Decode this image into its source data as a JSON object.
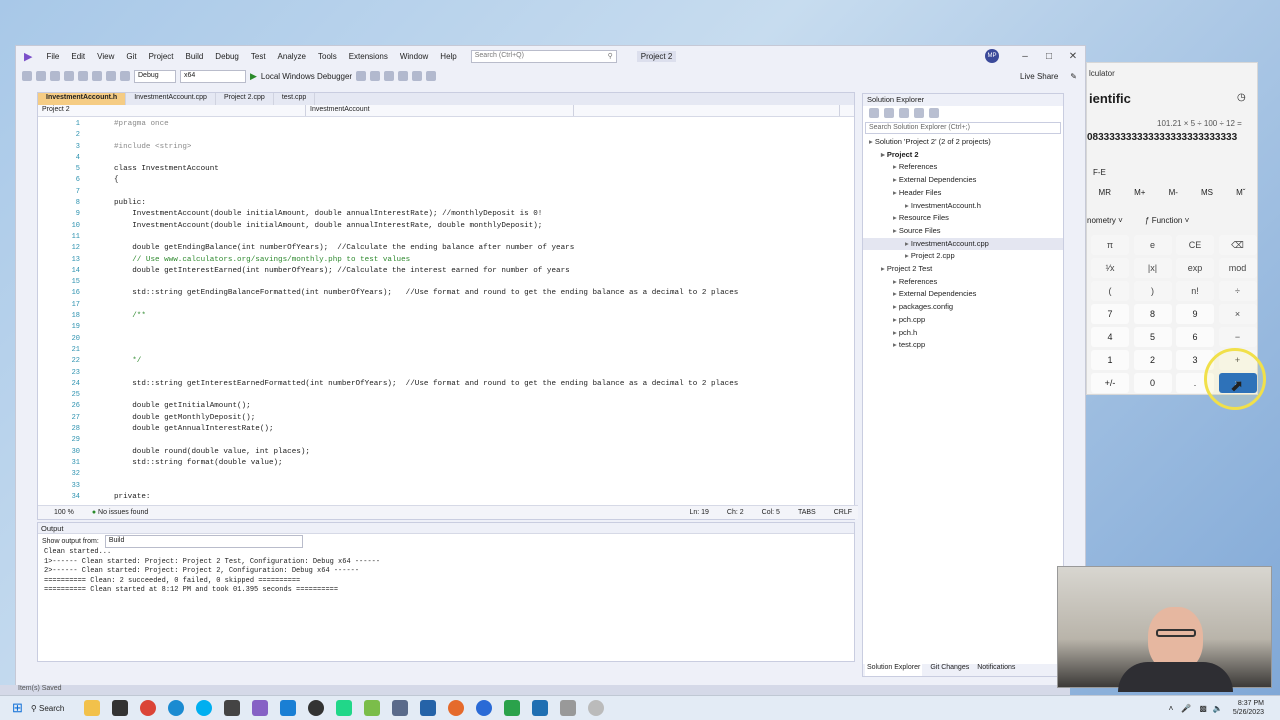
{
  "vs": {
    "menu": [
      "File",
      "Edit",
      "View",
      "Git",
      "Project",
      "Build",
      "Debug",
      "Test",
      "Analyze",
      "Tools",
      "Extensions",
      "Window",
      "Help"
    ],
    "search_placeholder": "Search (Ctrl+Q)",
    "project_name": "Project 2",
    "avatar": "MP",
    "live_share": "Live Share",
    "toolbar": {
      "config": "Debug",
      "platform": "x64",
      "debugger": "Local Windows Debugger"
    },
    "tabs": [
      "InvestmentAccount.h",
      "InvestmentAccount.cpp",
      "Project 2.cpp",
      "test.cpp"
    ],
    "nav": {
      "project": "Project 2",
      "scope": "InvestmentAccount"
    },
    "code_lines": [
      {
        "n": "1",
        "t": "#pragma once"
      },
      {
        "n": "2",
        "t": ""
      },
      {
        "n": "3",
        "t": "#include <string>"
      },
      {
        "n": "4",
        "t": ""
      },
      {
        "n": "5",
        "t": "class InvestmentAccount"
      },
      {
        "n": "6",
        "t": "{"
      },
      {
        "n": "7",
        "t": ""
      },
      {
        "n": "8",
        "t": "public:"
      },
      {
        "n": "9",
        "t": "    InvestmentAccount(double initialAmount, double annualInterestRate); //monthlyDeposit is 0!"
      },
      {
        "n": "10",
        "t": "    InvestmentAccount(double initialAmount, double annualInterestRate, double monthlyDeposit);"
      },
      {
        "n": "11",
        "t": ""
      },
      {
        "n": "12",
        "t": "    double getEndingBalance(int numberOfYears);  //Calculate the ending balance after number of years"
      },
      {
        "n": "13",
        "t": "    // Use www.calculators.org/savings/monthly.php to test values"
      },
      {
        "n": "14",
        "t": "    double getInterestEarned(int numberOfYears); //Calculate the interest earned for number of years"
      },
      {
        "n": "15",
        "t": ""
      },
      {
        "n": "16",
        "t": "    std::string getEndingBalanceFormatted(int numberOfYears);   //Use format and round to get the ending balance as a decimal to 2 places"
      },
      {
        "n": "17",
        "t": ""
      },
      {
        "n": "18",
        "t": "    /**"
      },
      {
        "n": "19",
        "t": ""
      },
      {
        "n": "20",
        "t": ""
      },
      {
        "n": "21",
        "t": ""
      },
      {
        "n": "22",
        "t": "    */"
      },
      {
        "n": "23",
        "t": ""
      },
      {
        "n": "24",
        "t": "    std::string getInterestEarnedFormatted(int numberOfYears);  //Use format and round to get the ending balance as a decimal to 2 places"
      },
      {
        "n": "25",
        "t": ""
      },
      {
        "n": "26",
        "t": "    double getInitialAmount();"
      },
      {
        "n": "27",
        "t": "    double getMonthlyDeposit();"
      },
      {
        "n": "28",
        "t": "    double getAnnualInterestRate();"
      },
      {
        "n": "29",
        "t": ""
      },
      {
        "n": "30",
        "t": "    double round(double value, int places);"
      },
      {
        "n": "31",
        "t": "    std::string format(double value);"
      },
      {
        "n": "32",
        "t": ""
      },
      {
        "n": "33",
        "t": ""
      },
      {
        "n": "34",
        "t": "private:"
      }
    ],
    "editor_status": {
      "zoom": "100 %",
      "issues": "No issues found",
      "ln": "Ln: 19",
      "ch": "Ch: 2",
      "col": "Col: 5",
      "tabs": "TABS",
      "eol": "CRLF"
    },
    "output": {
      "title": "Output",
      "show_from_label": "Show output from:",
      "source": "Build",
      "lines": [
        "Clean started...",
        "1>------ Clean started: Project: Project 2 Test, Configuration: Debug x64 ------",
        "2>------ Clean started: Project: Project 2, Configuration: Debug x64 ------",
        "========== Clean: 2 succeeded, 0 failed, 0 skipped ==========",
        "========== Clean started at 8:12 PM and took 01.395 seconds =========="
      ]
    },
    "solution": {
      "title": "Solution Explorer",
      "search": "Search Solution Explorer (Ctrl+;)",
      "items": [
        {
          "indent": 0,
          "label": "Solution 'Project 2' (2 of 2 projects)"
        },
        {
          "indent": 1,
          "label": "Project 2",
          "bold": true
        },
        {
          "indent": 2,
          "label": "References"
        },
        {
          "indent": 2,
          "label": "External Dependencies"
        },
        {
          "indent": 2,
          "label": "Header Files"
        },
        {
          "indent": 3,
          "label": "InvestmentAccount.h"
        },
        {
          "indent": 2,
          "label": "Resource Files"
        },
        {
          "indent": 2,
          "label": "Source Files"
        },
        {
          "indent": 3,
          "label": "InvestmentAccount.cpp",
          "selected": true
        },
        {
          "indent": 3,
          "label": "Project 2.cpp"
        },
        {
          "indent": 1,
          "label": "Project 2 Test"
        },
        {
          "indent": 2,
          "label": "References"
        },
        {
          "indent": 2,
          "label": "External Dependencies"
        },
        {
          "indent": 2,
          "label": "packages.config"
        },
        {
          "indent": 2,
          "label": "pch.cpp"
        },
        {
          "indent": 2,
          "label": "pch.h"
        },
        {
          "indent": 2,
          "label": "test.cpp"
        }
      ],
      "bottom_tabs": [
        "Solution Explorer",
        "Git Changes",
        "Notifications"
      ]
    },
    "status_left": "Item(s) Saved"
  },
  "calc": {
    "title": "lculator",
    "mode": "ientific",
    "expression": "101.21 × 5 ÷ 100 ÷ 12 =",
    "result": "083333333333333333333333333",
    "fe": "F-E",
    "memory": [
      "MR",
      "M+",
      "M-",
      "MS",
      "Mˇ"
    ],
    "trig": "nometry",
    "function": "Function",
    "keys": [
      [
        "π",
        "e",
        "CE",
        "⌫"
      ],
      [
        "¹⁄x",
        "|x|",
        "exp",
        "mod"
      ],
      [
        "(",
        ")",
        "n!",
        "÷"
      ],
      [
        "7",
        "8",
        "9",
        "×"
      ],
      [
        "4",
        "5",
        "6",
        "−"
      ],
      [
        "1",
        "2",
        "3",
        "+"
      ],
      [
        "+/-",
        "0",
        ".",
        "="
      ]
    ]
  },
  "taskbar": {
    "search": "Search",
    "time": "8:37 PM",
    "date": "5/26/2023"
  }
}
